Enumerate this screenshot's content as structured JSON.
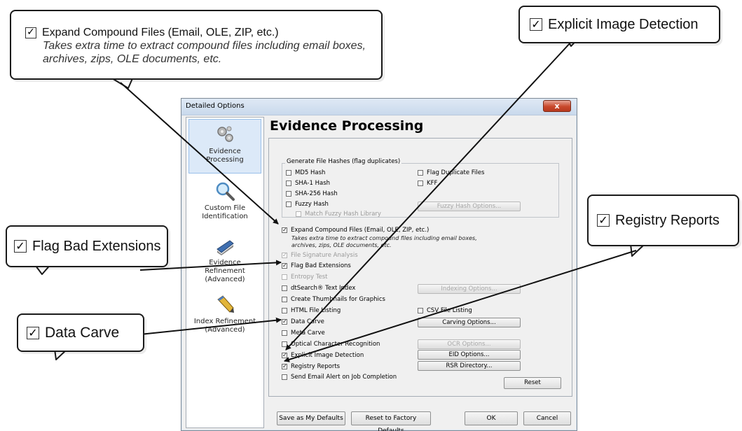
{
  "dialog": {
    "title": "Detailed Options",
    "close_glyph": "x",
    "panel_title": "Evidence Processing"
  },
  "nav": {
    "items": [
      {
        "label": "Evidence Processing",
        "icon": "gears-icon",
        "selected": true
      },
      {
        "label": "Custom File Identification",
        "icon": "magnifier-icon",
        "selected": false
      },
      {
        "label": "Evidence Refinement (Advanced)",
        "icon": "stapler-icon",
        "selected": false
      },
      {
        "label": "Index Refinement (Advanced)",
        "icon": "pencil-icon",
        "selected": false
      }
    ]
  },
  "hashes": {
    "legend": "Generate File Hashes (flag duplicates)",
    "md5": "MD5 Hash",
    "sha1": "SHA-1 Hash",
    "sha256": "SHA-256 Hash",
    "fuzzy": "Fuzzy Hash",
    "match_fuzzy": "Match Fuzzy Hash Library",
    "flag_duplicates": "Flag Duplicate Files",
    "kff": "KFF",
    "fuzzy_options": "Fuzzy Hash Options..."
  },
  "options": {
    "expand_compound": "Expand Compound Files (Email, OLE, ZIP, etc.)",
    "expand_desc_1": "Takes extra time to extract compound files including email boxes,",
    "expand_desc_2": "archives, zips, OLE documents, etc.",
    "file_signature": "File Signature Analysis",
    "flag_bad_ext": "Flag Bad Extensions",
    "entropy": "Entropy Test",
    "dtsearch": "dtSearch® Text Index",
    "indexing_options": "Indexing Options...",
    "thumbnails": "Create Thumbnails for Graphics",
    "html_listing": "HTML File Listing",
    "csv_listing": "CSV File Listing",
    "data_carve": "Data Carve",
    "carving_options": "Carving Options...",
    "meta_carve": "Meta Carve",
    "ocr": "Optical Character Recognition",
    "ocr_options": "OCR Options...",
    "eid": "Explicit Image Detection",
    "eid_options": "EID Options...",
    "registry": "Registry Reports",
    "rsr_directory": "RSR Directory...",
    "email_alert": "Send Email Alert on Job Completion",
    "reset": "Reset"
  },
  "footer": {
    "save_defaults": "Save as My Defaults",
    "reset_factory": "Reset to Factory Defaults",
    "ok": "OK",
    "cancel": "Cancel"
  },
  "callouts": {
    "expand_title": "Expand Compound Files (Email, OLE, ZIP, etc.)",
    "expand_desc_1": "Takes extra time to extract compound files including email boxes,",
    "expand_desc_2": "archives, zips, OLE documents, etc.",
    "explicit": "Explicit Image Detection",
    "registry": "Registry Reports",
    "flag_bad": "Flag Bad Extensions",
    "data_carve": "Data Carve",
    "check_glyph": "✓"
  },
  "colors": {
    "close_button": "#c8482c",
    "nav_selected": "#dce9f8",
    "arrow": "#111111"
  }
}
